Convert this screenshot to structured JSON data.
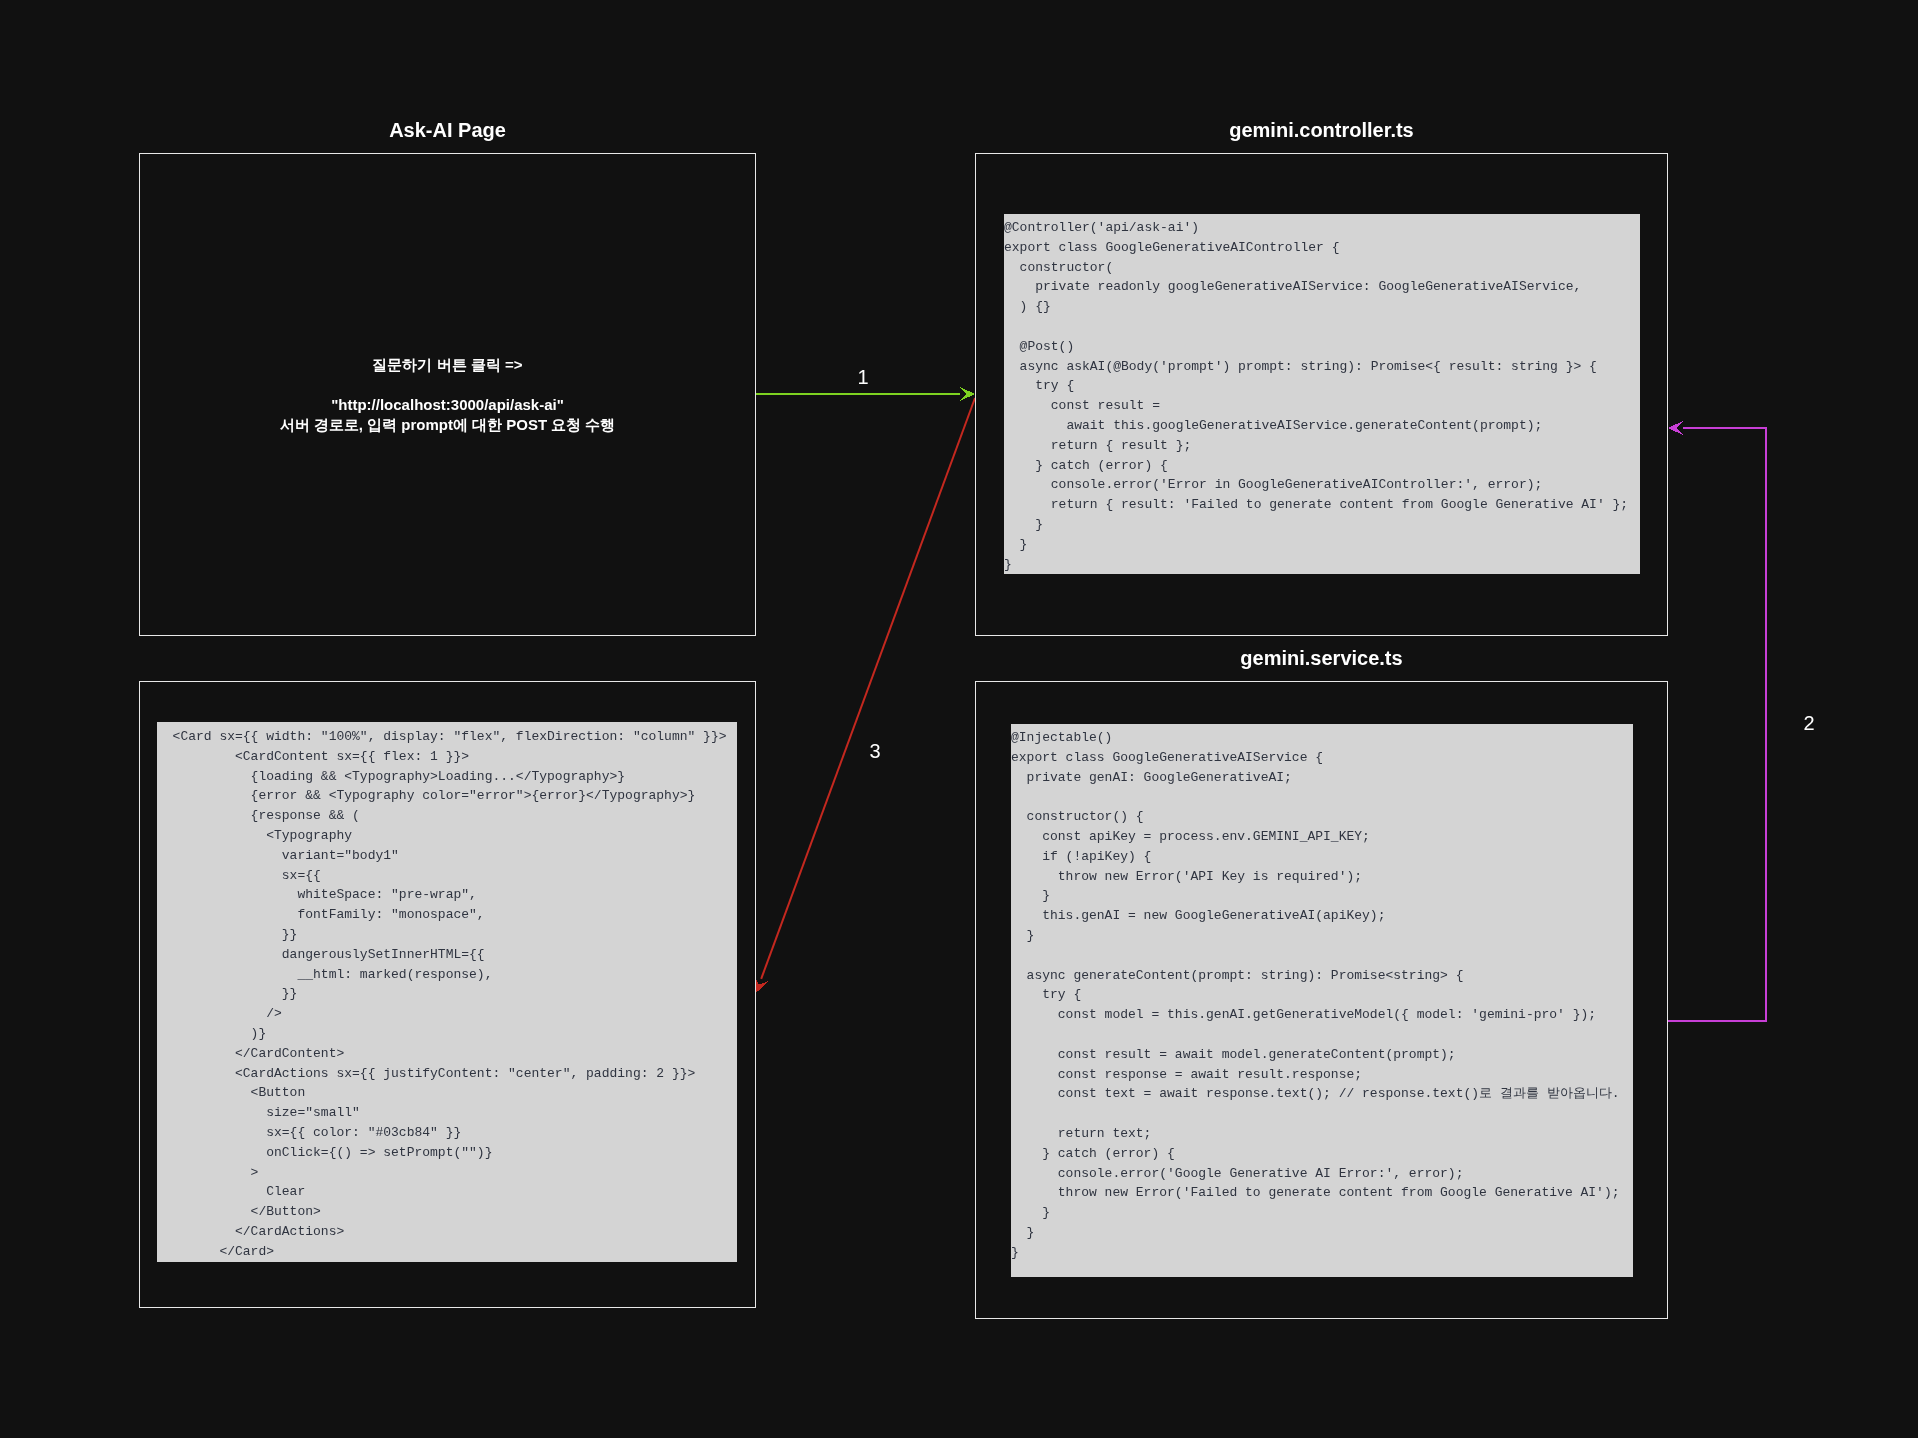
{
  "nodes": [
    {
      "kind": "text",
      "title": "Ask-AI Page",
      "paragraphs": [
        [
          "질문하기 버튼 클릭 =>"
        ],
        [
          "\"http://localhost:3000/api/ask-ai\"",
          "서버 경로로, 입력 prompt에 대한 POST 요청 수행"
        ]
      ]
    },
    {
      "kind": "code",
      "code": "  <Card sx={{ width: \"100%\", display: \"flex\", flexDirection: \"column\" }}>\n          <CardContent sx={{ flex: 1 }}>\n            {loading && <Typography>Loading...</Typography>}\n            {error && <Typography color=\"error\">{error}</Typography>}\n            {response && (\n              <Typography\n                variant=\"body1\"\n                sx={{\n                  whiteSpace: \"pre-wrap\",\n                  fontFamily: \"monospace\",\n                }}\n                dangerouslySetInnerHTML={{\n                  __html: marked(response),\n                }}\n              />\n            )}\n          </CardContent>\n          <CardActions sx={{ justifyContent: \"center\", padding: 2 }}>\n            <Button\n              size=\"small\"\n              sx={{ color: \"#03cb84\" }}\n              onClick={() => setPrompt(\"\")}\n            >\n              Clear\n            </Button>\n          </CardActions>\n        </Card>"
    },
    {
      "kind": "code",
      "title": "gemini.controller.ts",
      "code": "@Controller('api/ask-ai')\nexport class GoogleGenerativeAIController {\n  constructor(\n    private readonly googleGenerativeAIService: GoogleGenerativeAIService,\n  ) {}\n\n  @Post()\n  async askAI(@Body('prompt') prompt: string): Promise<{ result: string }> {\n    try {\n      const result =\n        await this.googleGenerativeAIService.generateContent(prompt);\n      return { result };\n    } catch (error) {\n      console.error('Error in GoogleGenerativeAIController:', error);\n      return { result: 'Failed to generate content from Google Generative AI' };\n    }\n  }\n}"
    },
    {
      "kind": "code",
      "title": "gemini.service.ts",
      "code": "@Injectable()\nexport class GoogleGenerativeAIService {\n  private genAI: GoogleGenerativeAI;\n\n  constructor() {\n    const apiKey = process.env.GEMINI_API_KEY;\n    if (!apiKey) {\n      throw new Error('API Key is required');\n    }\n    this.genAI = new GoogleGenerativeAI(apiKey);\n  }\n\n  async generateContent(prompt: string): Promise<string> {\n    try {\n      const model = this.genAI.getGenerativeModel({ model: 'gemini-pro' });\n\n      const result = await model.generateContent(prompt);\n      const response = await result.response;\n      const text = await response.text(); // response.text()로 결과를 받아옵니다.\n\n      return text;\n    } catch (error) {\n      console.error('Google Generative AI Error:', error);\n      throw new Error('Failed to generate content from Google Generative AI');\n    }\n  }\n}"
    }
  ],
  "arrows": [
    {
      "label": "1",
      "color": "#7ed321"
    },
    {
      "label": "2",
      "color": "#c83fd6"
    },
    {
      "label": "3",
      "color": "#c4281f"
    }
  ]
}
